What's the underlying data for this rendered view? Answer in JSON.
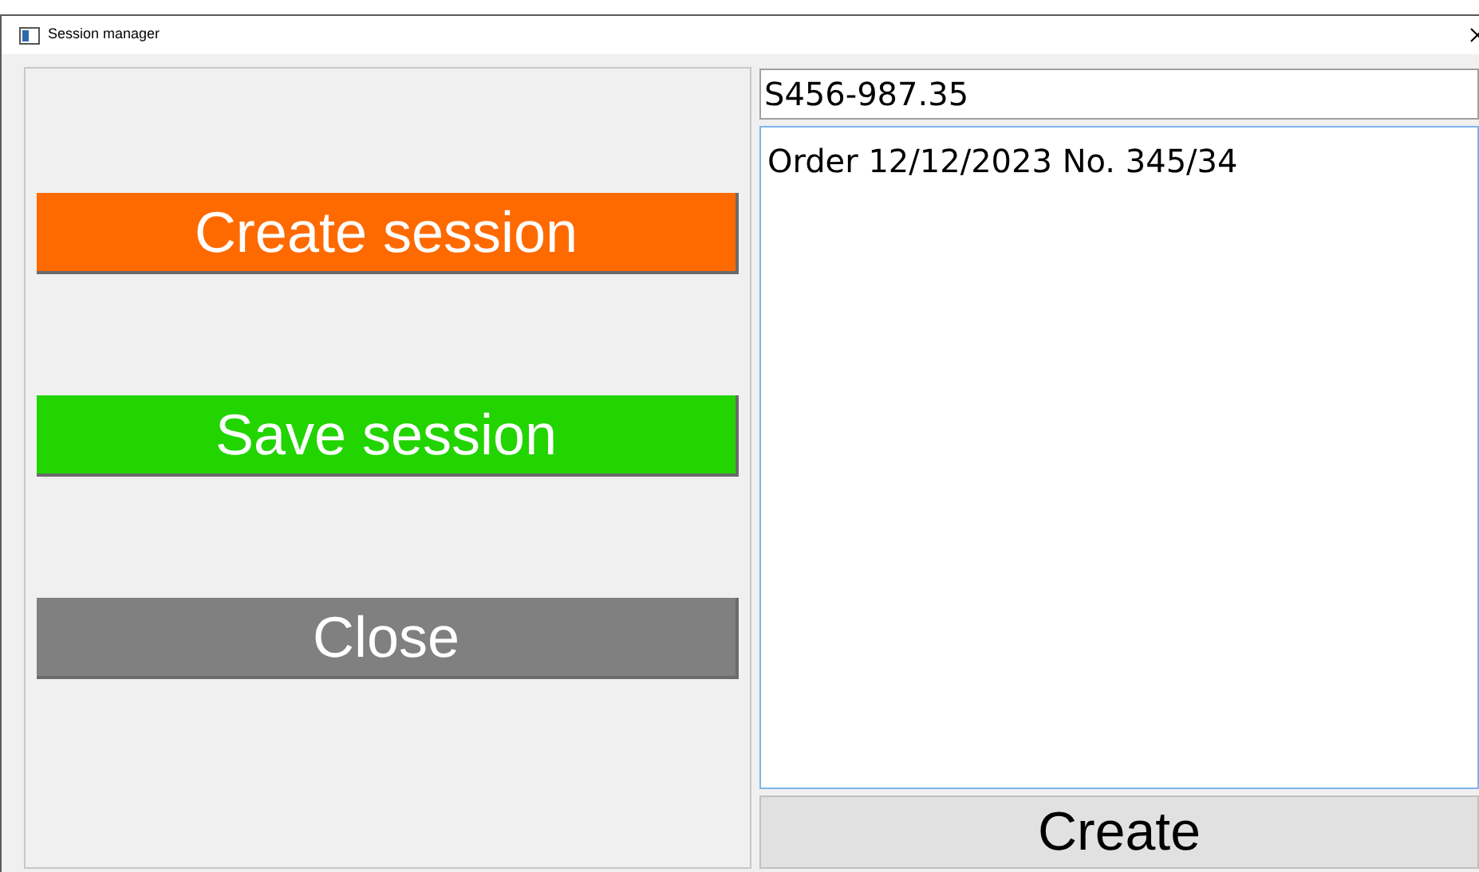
{
  "window": {
    "title": "Session manager"
  },
  "actions": [
    {
      "label": "Create session",
      "color": "#ff6a00"
    },
    {
      "label": "Save session",
      "color": "#22d400"
    },
    {
      "label": "Close",
      "color": "#808080"
    }
  ],
  "code_field": {
    "value": "S456-987.35"
  },
  "notes_field": {
    "value": "Order 12/12/2023 No. 345/34"
  },
  "submit_button": {
    "label": "Create"
  }
}
